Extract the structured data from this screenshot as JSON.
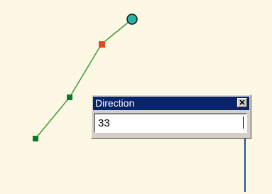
{
  "dialog": {
    "title": "Direction",
    "close_icon": "close-x-icon",
    "input_value": "33"
  },
  "sketch": {
    "line_color": "#3a9e3a",
    "vertex_color": "#0a7a2a",
    "current_vertex_color": "#e04a1e",
    "endpoint_color": "#27b3a3"
  },
  "colors": {
    "canvas": "#fcf8e3",
    "titlebar": "#0a246a",
    "callout": "#1f4e9e"
  }
}
